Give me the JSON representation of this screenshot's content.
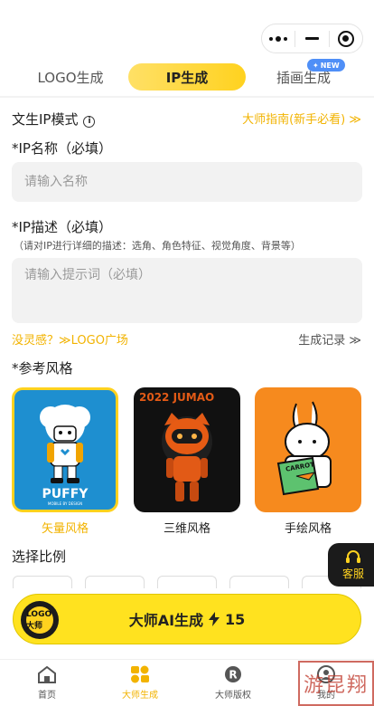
{
  "header": {
    "capsule": {
      "more_icon": "more-dots-icon",
      "minimize_icon": "minus-icon",
      "close_icon": "target-circle-icon"
    }
  },
  "tabs": [
    {
      "label": "LOGO生成"
    },
    {
      "label": "IP生成",
      "active": true
    },
    {
      "label": "插画生成",
      "badge": "NEW"
    }
  ],
  "mode": {
    "title": "文生IP模式",
    "info_icon": "i",
    "guide_link": "大师指南(新手必看) ≫"
  },
  "name_field": {
    "label": "*IP名称（必填）",
    "placeholder": "请输入名称"
  },
  "desc_field": {
    "label": "*IP描述（必填）",
    "hint": "（请对IP进行详细的描述：选角、角色特征、视觉角度、背景等）",
    "placeholder": "请输入提示词（必填）"
  },
  "links": {
    "inspiration": "没灵感？≫LOGO广场",
    "history": "生成记录 ≫"
  },
  "style": {
    "title": "*参考风格",
    "options": [
      {
        "label": "矢量风格",
        "selected": true,
        "image_text": "PUFFY",
        "image_subtext": "MOBILE BY DESIGN"
      },
      {
        "label": "三维风格",
        "selected": false,
        "image_text": "2022 JUMAO"
      },
      {
        "label": "手绘风格",
        "selected": false,
        "image_text": "CARROT"
      }
    ]
  },
  "ratio": {
    "title": "选择比例"
  },
  "service": {
    "label": "客服",
    "icon": "headset-icon"
  },
  "cta": {
    "logo_text": "LOGO大师",
    "label": "大师AI生成",
    "bolt_icon": "lightning-icon",
    "cost": "15"
  },
  "tabbar": [
    {
      "label": "首页",
      "icon": "home-icon",
      "active": false
    },
    {
      "label": "大师生成",
      "icon": "logo-grid-icon",
      "active": true
    },
    {
      "label": "大师版权",
      "icon": "registered-icon",
      "active": false
    },
    {
      "label": "我的",
      "icon": "user-icon",
      "active": false
    }
  ],
  "watermark": {
    "text": "游昆翔"
  },
  "colors": {
    "accent": "#FFD21F",
    "accent_text": "#F2B300",
    "badge": "#4F8FF7",
    "dark": "#1B1B1B"
  }
}
